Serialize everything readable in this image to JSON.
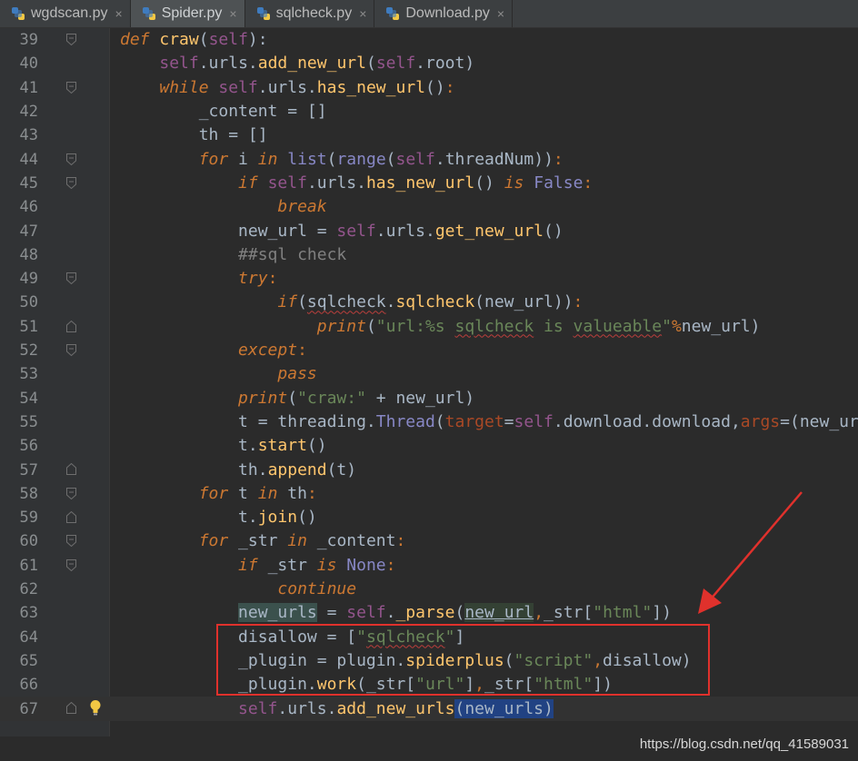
{
  "tabs": [
    {
      "label": "wgdscan.py",
      "active": false
    },
    {
      "label": "Spider.py",
      "active": true
    },
    {
      "label": "sqlcheck.py",
      "active": false
    },
    {
      "label": "Download.py",
      "active": false
    }
  ],
  "close_glyph": "×",
  "line_numbers": [
    "39",
    "40",
    "41",
    "42",
    "43",
    "44",
    "45",
    "46",
    "47",
    "48",
    "49",
    "50",
    "51",
    "52",
    "53",
    "54",
    "55",
    "56",
    "57",
    "58",
    "59",
    "60",
    "61",
    "62",
    "63",
    "64",
    "65",
    "66",
    "67"
  ],
  "watermark": "https://blog.csdn.net/qq_41589031",
  "colors": {
    "background": "#2b2b2b",
    "keyword": "#cc7832",
    "string": "#6a8759",
    "annotation": "#e0312c"
  }
}
